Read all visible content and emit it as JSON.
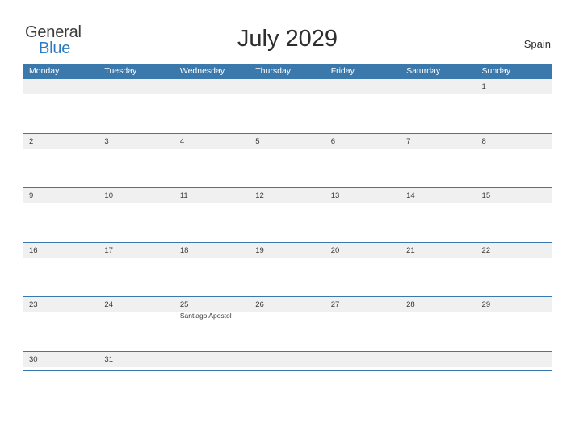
{
  "header": {
    "logo_general": "General",
    "logo_blue": "Blue",
    "logo_flag_icon": "flag-icon",
    "title": "July 2029",
    "country": "Spain"
  },
  "calendar": {
    "weekday_headers": [
      "Monday",
      "Tuesday",
      "Wednesday",
      "Thursday",
      "Friday",
      "Saturday",
      "Sunday"
    ],
    "accent_color": "#3b78ab",
    "shade_color": "#f0f0f0",
    "weeks": [
      [
        {
          "num": "",
          "event": ""
        },
        {
          "num": "",
          "event": ""
        },
        {
          "num": "",
          "event": ""
        },
        {
          "num": "",
          "event": ""
        },
        {
          "num": "",
          "event": ""
        },
        {
          "num": "",
          "event": ""
        },
        {
          "num": "1",
          "event": ""
        }
      ],
      [
        {
          "num": "2",
          "event": ""
        },
        {
          "num": "3",
          "event": ""
        },
        {
          "num": "4",
          "event": ""
        },
        {
          "num": "5",
          "event": ""
        },
        {
          "num": "6",
          "event": ""
        },
        {
          "num": "7",
          "event": ""
        },
        {
          "num": "8",
          "event": ""
        }
      ],
      [
        {
          "num": "9",
          "event": ""
        },
        {
          "num": "10",
          "event": ""
        },
        {
          "num": "11",
          "event": ""
        },
        {
          "num": "12",
          "event": ""
        },
        {
          "num": "13",
          "event": ""
        },
        {
          "num": "14",
          "event": ""
        },
        {
          "num": "15",
          "event": ""
        }
      ],
      [
        {
          "num": "16",
          "event": ""
        },
        {
          "num": "17",
          "event": ""
        },
        {
          "num": "18",
          "event": ""
        },
        {
          "num": "19",
          "event": ""
        },
        {
          "num": "20",
          "event": ""
        },
        {
          "num": "21",
          "event": ""
        },
        {
          "num": "22",
          "event": ""
        }
      ],
      [
        {
          "num": "23",
          "event": ""
        },
        {
          "num": "24",
          "event": ""
        },
        {
          "num": "25",
          "event": "Santiago Apostol"
        },
        {
          "num": "26",
          "event": ""
        },
        {
          "num": "27",
          "event": ""
        },
        {
          "num": "28",
          "event": ""
        },
        {
          "num": "29",
          "event": ""
        }
      ],
      [
        {
          "num": "30",
          "event": ""
        },
        {
          "num": "31",
          "event": ""
        },
        {
          "num": "",
          "event": ""
        },
        {
          "num": "",
          "event": ""
        },
        {
          "num": "",
          "event": ""
        },
        {
          "num": "",
          "event": ""
        },
        {
          "num": "",
          "event": ""
        }
      ]
    ]
  }
}
